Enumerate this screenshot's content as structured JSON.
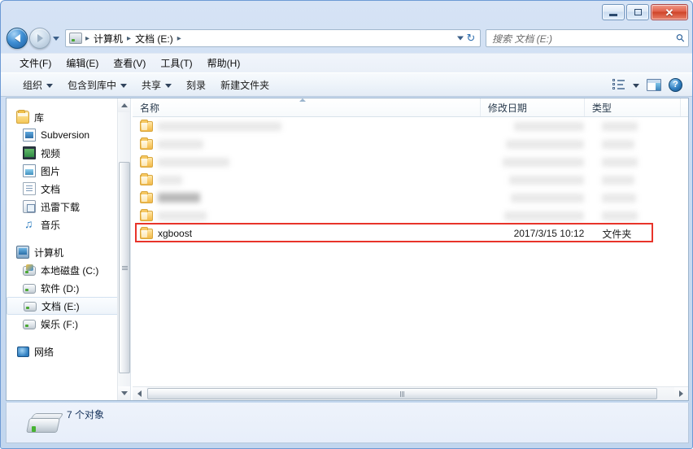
{
  "window": {
    "title": "",
    "buttons": {
      "minimize": "–",
      "maximize": "□",
      "close": "✕"
    }
  },
  "addressbar": {
    "back_tooltip": "后退",
    "forward_tooltip": "前进",
    "crumbs": [
      "计算机",
      "文档 (E:)"
    ],
    "separator": "▸",
    "refresh_glyph": "↻"
  },
  "search": {
    "placeholder": "搜索 文档 (E:)",
    "value": "",
    "icon_glyph": "⌕"
  },
  "menubar": {
    "items": [
      {
        "label": "文件(F)"
      },
      {
        "label": "编辑(E)"
      },
      {
        "label": "查看(V)"
      },
      {
        "label": "工具(T)"
      },
      {
        "label": "帮助(H)"
      }
    ]
  },
  "commandbar": {
    "items": [
      {
        "label": "组织",
        "has_caret": true
      },
      {
        "label": "包含到库中",
        "has_caret": true
      },
      {
        "label": "共享",
        "has_caret": true
      },
      {
        "label": "刻录",
        "has_caret": false
      },
      {
        "label": "新建文件夹",
        "has_caret": false
      }
    ],
    "right_icons": [
      {
        "name": "view-options-icon"
      },
      {
        "name": "preview-pane-icon"
      },
      {
        "name": "help-icon",
        "glyph": "?"
      }
    ]
  },
  "sidebar": {
    "groups": [
      {
        "name": "库",
        "icon": "library-icon",
        "items": [
          {
            "label": "Subversion",
            "icon": "svn-icon"
          },
          {
            "label": "视频",
            "icon": "video-icon"
          },
          {
            "label": "图片",
            "icon": "pictures-icon"
          },
          {
            "label": "文档",
            "icon": "documents-icon"
          },
          {
            "label": "迅雷下载",
            "icon": "download-icon"
          },
          {
            "label": "音乐",
            "icon": "music-icon"
          }
        ]
      },
      {
        "name": "计算机",
        "icon": "computer-icon",
        "items": [
          {
            "label": "本地磁盘 (C:)",
            "icon": "system-drive-icon",
            "selected": false
          },
          {
            "label": "软件 (D:)",
            "icon": "drive-icon",
            "selected": false
          },
          {
            "label": "文档 (E:)",
            "icon": "drive-icon",
            "selected": true
          },
          {
            "label": "娱乐 (F:)",
            "icon": "drive-icon",
            "selected": false
          }
        ]
      },
      {
        "name": "网络",
        "icon": "network-icon",
        "items": []
      }
    ]
  },
  "filelist": {
    "columns": [
      {
        "key": "name",
        "label": "名称",
        "sorted": true
      },
      {
        "key": "date",
        "label": "修改日期",
        "sorted": false
      },
      {
        "key": "type",
        "label": "类型",
        "sorted": false
      }
    ],
    "rows": [
      {
        "name": "",
        "date": "",
        "type": "",
        "icon": "folder-icon",
        "redacted": true,
        "blur": {
          "name_w": 152,
          "date_w": 86,
          "type_w": 44,
          "shade": "light"
        }
      },
      {
        "name": "",
        "date": "",
        "type": "",
        "icon": "folder-icon",
        "redacted": true,
        "blur": {
          "name_w": 56,
          "date_w": 96,
          "type_w": 40,
          "shade": "light"
        }
      },
      {
        "name": "",
        "date": "",
        "type": "",
        "icon": "folder-icon",
        "redacted": true,
        "blur": {
          "name_w": 88,
          "date_w": 100,
          "type_w": 44,
          "shade": "light"
        }
      },
      {
        "name": "",
        "date": "",
        "type": "",
        "icon": "folder-icon",
        "redacted": true,
        "blur": {
          "name_w": 30,
          "date_w": 92,
          "type_w": 40,
          "shade": "light"
        }
      },
      {
        "name": "",
        "date": "",
        "type": "",
        "icon": "folder-icon",
        "redacted": true,
        "blur": {
          "name_w": 52,
          "date_w": 90,
          "type_w": 42,
          "shade": "dark"
        }
      },
      {
        "name": "",
        "date": "",
        "type": "",
        "icon": "folder-icon",
        "redacted": true,
        "blur": {
          "name_w": 60,
          "date_w": 98,
          "type_w": 44,
          "shade": "light"
        }
      },
      {
        "name": "xgboost",
        "date": "2017/3/15 10:12",
        "type": "文件夹",
        "icon": "folder-icon",
        "redacted": false,
        "highlighted": true
      }
    ],
    "annotation": {
      "color": "#e8342a",
      "target_row_index": 6
    }
  },
  "statusbar": {
    "item_count_text": "7 个对象",
    "drive_icon": "drive-icon"
  }
}
